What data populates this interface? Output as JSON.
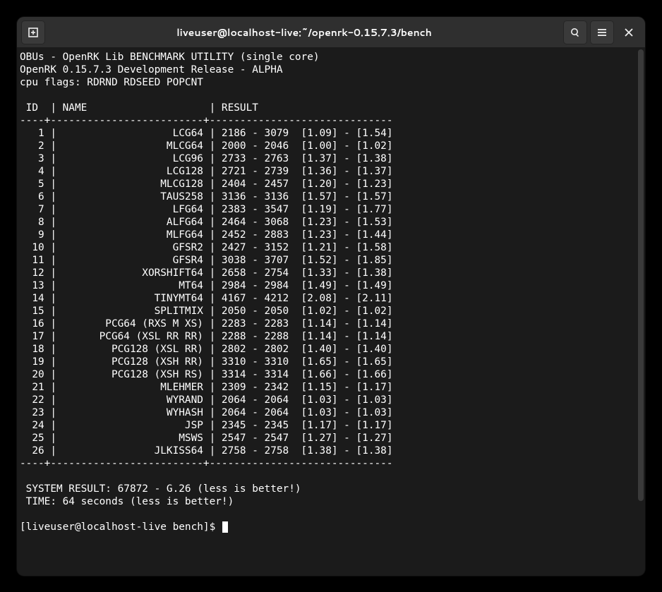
{
  "window": {
    "title": "liveuser@localhost-live:~/openrk-0.15.7.3/bench"
  },
  "output": {
    "header1": "OBUs - OpenRK Lib BENCHMARK UTILITY (single core)",
    "header2": "OpenRK 0.15.7.3 Development Release - ALPHA",
    "header3": "cpu flags: RDRND RDSEED POPCNT",
    "cols": " ID  | NAME                    | RESULT",
    "sep": "----+-------------------------+------------------------------",
    "rows": [
      {
        "id": 1,
        "name": "LCG64",
        "r1": 2186,
        "r2": 3079,
        "m1": "1.09",
        "m2": "1.54"
      },
      {
        "id": 2,
        "name": "MLCG64",
        "r1": 2000,
        "r2": 2046,
        "m1": "1.00",
        "m2": "1.02"
      },
      {
        "id": 3,
        "name": "LCG96",
        "r1": 2733,
        "r2": 2763,
        "m1": "1.37",
        "m2": "1.38"
      },
      {
        "id": 4,
        "name": "LCG128",
        "r1": 2721,
        "r2": 2739,
        "m1": "1.36",
        "m2": "1.37"
      },
      {
        "id": 5,
        "name": "MLCG128",
        "r1": 2404,
        "r2": 2457,
        "m1": "1.20",
        "m2": "1.23"
      },
      {
        "id": 6,
        "name": "TAUS258",
        "r1": 3136,
        "r2": 3136,
        "m1": "1.57",
        "m2": "1.57"
      },
      {
        "id": 7,
        "name": "LFG64",
        "r1": 2383,
        "r2": 3547,
        "m1": "1.19",
        "m2": "1.77"
      },
      {
        "id": 8,
        "name": "ALFG64",
        "r1": 2464,
        "r2": 3068,
        "m1": "1.23",
        "m2": "1.53"
      },
      {
        "id": 9,
        "name": "MLFG64",
        "r1": 2452,
        "r2": 2883,
        "m1": "1.23",
        "m2": "1.44"
      },
      {
        "id": 10,
        "name": "GFSR2",
        "r1": 2427,
        "r2": 3152,
        "m1": "1.21",
        "m2": "1.58"
      },
      {
        "id": 11,
        "name": "GFSR4",
        "r1": 3038,
        "r2": 3707,
        "m1": "1.52",
        "m2": "1.85"
      },
      {
        "id": 12,
        "name": "XORSHIFT64",
        "r1": 2658,
        "r2": 2754,
        "m1": "1.33",
        "m2": "1.38"
      },
      {
        "id": 13,
        "name": "MT64",
        "r1": 2984,
        "r2": 2984,
        "m1": "1.49",
        "m2": "1.49"
      },
      {
        "id": 14,
        "name": "TINYMT64",
        "r1": 4167,
        "r2": 4212,
        "m1": "2.08",
        "m2": "2.11"
      },
      {
        "id": 15,
        "name": "SPLITMIX",
        "r1": 2050,
        "r2": 2050,
        "m1": "1.02",
        "m2": "1.02"
      },
      {
        "id": 16,
        "name": "PCG64 (RXS M XS)",
        "r1": 2283,
        "r2": 2283,
        "m1": "1.14",
        "m2": "1.14"
      },
      {
        "id": 17,
        "name": "PCG64 (XSL RR RR)",
        "r1": 2288,
        "r2": 2288,
        "m1": "1.14",
        "m2": "1.14"
      },
      {
        "id": 18,
        "name": "PCG128 (XSL RR)",
        "r1": 2802,
        "r2": 2802,
        "m1": "1.40",
        "m2": "1.40"
      },
      {
        "id": 19,
        "name": "PCG128 (XSH RR)",
        "r1": 3310,
        "r2": 3310,
        "m1": "1.65",
        "m2": "1.65"
      },
      {
        "id": 20,
        "name": "PCG128 (XSH RS)",
        "r1": 3314,
        "r2": 3314,
        "m1": "1.66",
        "m2": "1.66"
      },
      {
        "id": 21,
        "name": "MLEHMER",
        "r1": 2309,
        "r2": 2342,
        "m1": "1.15",
        "m2": "1.17"
      },
      {
        "id": 22,
        "name": "WYRAND",
        "r1": 2064,
        "r2": 2064,
        "m1": "1.03",
        "m2": "1.03"
      },
      {
        "id": 23,
        "name": "WYHASH",
        "r1": 2064,
        "r2": 2064,
        "m1": "1.03",
        "m2": "1.03"
      },
      {
        "id": 24,
        "name": "JSP",
        "r1": 2345,
        "r2": 2345,
        "m1": "1.17",
        "m2": "1.17"
      },
      {
        "id": 25,
        "name": "MSWS",
        "r1": 2547,
        "r2": 2547,
        "m1": "1.27",
        "m2": "1.27"
      },
      {
        "id": 26,
        "name": "JLKISS64",
        "r1": 2758,
        "r2": 2758,
        "m1": "1.38",
        "m2": "1.38"
      }
    ],
    "footer1": " SYSTEM RESULT: 67872 - G.26 (less is better!)",
    "footer2": " TIME: 64 seconds (less is better!)"
  },
  "prompt": "[liveuser@localhost-live bench]$ "
}
